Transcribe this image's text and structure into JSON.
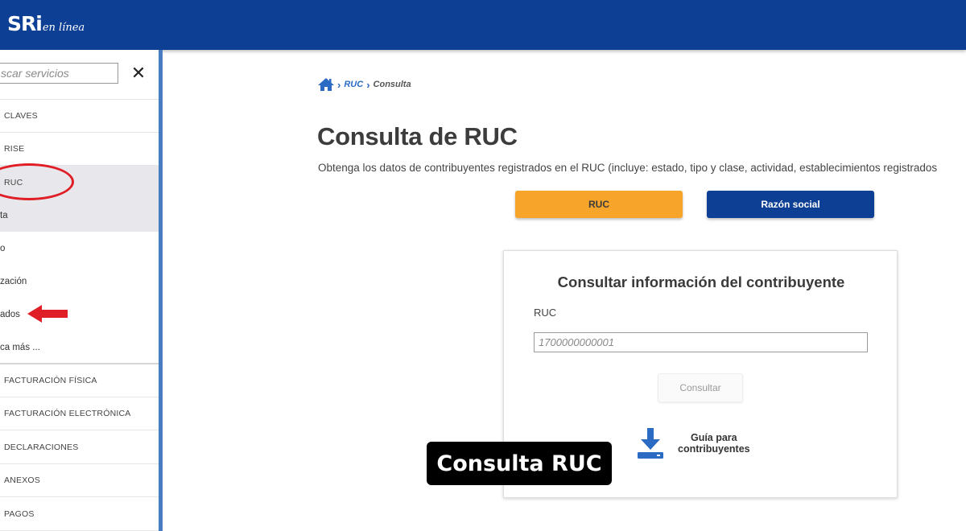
{
  "header": {
    "logo_main": "SRi",
    "logo_sub": "en línea"
  },
  "sidebar": {
    "search_placeholder": "scar servicios",
    "close_symbol": "✕",
    "items": [
      {
        "label": "CLAVES"
      },
      {
        "label": "RISE"
      },
      {
        "label": "RUC"
      }
    ],
    "sub_items": [
      {
        "label": "ta"
      },
      {
        "label": "o"
      },
      {
        "label": "zación"
      },
      {
        "label": "ados"
      },
      {
        "label": "ca más ..."
      }
    ],
    "items_bottom": [
      {
        "label": "FACTURACIÓN FÍSICA"
      },
      {
        "label": "FACTURACIÓN ELECTRÓNICA"
      },
      {
        "label": "DECLARACIONES"
      },
      {
        "label": "ANEXOS"
      },
      {
        "label": "PAGOS"
      }
    ]
  },
  "breadcrumb": {
    "home_icon": "home-icon",
    "items": [
      "RUC",
      "Consulta"
    ]
  },
  "main": {
    "title": "Consulta de RUC",
    "description": "Obtenga los datos de contribuyentes registrados en el RUC (incluye: estado, tipo y clase, actividad, establecimientos registrados",
    "tabs": [
      {
        "label": "RUC",
        "color": "#f7a42a"
      },
      {
        "label": "Razón social",
        "color": "#0d3f94"
      }
    ]
  },
  "card": {
    "title": "Consultar información del contribuyente",
    "field_label": "RUC",
    "field_placeholder": "1700000000001",
    "button_label": "Consultar",
    "guide_line1": "Guía para",
    "guide_line2": "contribuyentes"
  },
  "overlay": {
    "label": "Consulta RUC"
  },
  "colors": {
    "brand": "#0d3f94",
    "accent": "#f7a42a",
    "annotation": "#e01e26"
  }
}
